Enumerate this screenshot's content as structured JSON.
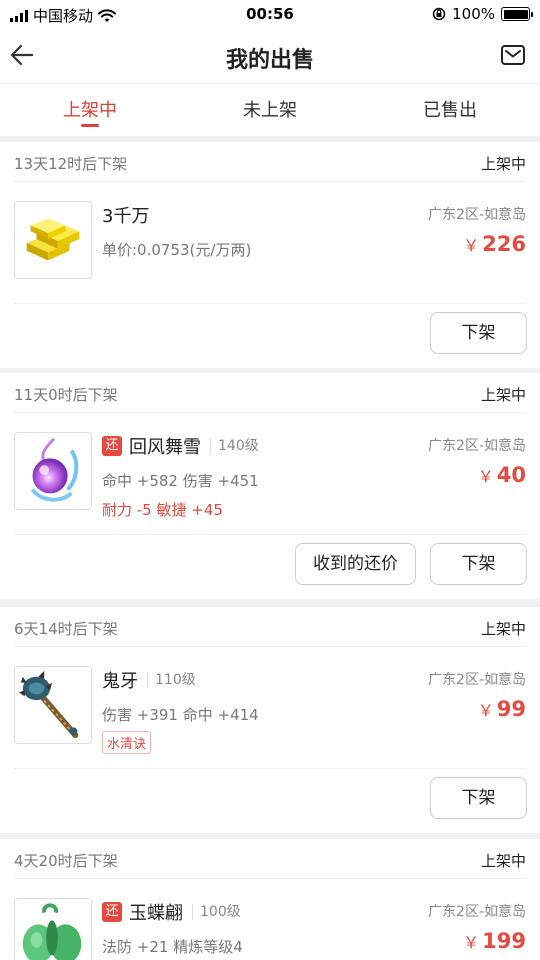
{
  "status_bar": {
    "carrier": "中国移动",
    "time": "00:56",
    "battery": "100%"
  },
  "nav": {
    "title": "我的出售",
    "back_icon": "back-arrow-icon",
    "mail_icon": "mail-icon"
  },
  "tabs": [
    {
      "label": "上架中",
      "active": true
    },
    {
      "label": "未上架",
      "active": false
    },
    {
      "label": "已售出",
      "active": false
    }
  ],
  "items": [
    {
      "expire": "13天12时后下架",
      "status": "上架中",
      "name": "3千万",
      "unit_price": "单价:0.0753(元/万两)",
      "server": "广东2区-如意岛",
      "currency": "￥",
      "price": "226",
      "icon": "gold-bars-icon",
      "buttons": {
        "off": "下架"
      }
    },
    {
      "expire": "11天0时后下架",
      "status": "上架中",
      "tag": "还",
      "name": "回风舞雪",
      "level": "140级",
      "attr": "命中 +582 伤害 +451",
      "attr2": "耐力 -5 敏捷 +45",
      "server": "广东2区-如意岛",
      "currency": "￥",
      "price": "40",
      "icon": "purple-orb-icon",
      "buttons": {
        "offers": "收到的还价",
        "off": "下架"
      }
    },
    {
      "expire": "6天14时后下架",
      "status": "上架中",
      "name": "鬼牙",
      "level": "110级",
      "attr": "伤害 +391 命中 +414",
      "special_tag": "水清诀",
      "server": "广东2区-如意岛",
      "currency": "￥",
      "price": "99",
      "icon": "spiked-mace-icon",
      "buttons": {
        "off": "下架"
      }
    },
    {
      "expire": "4天20时后下架",
      "status": "上架中",
      "tag": "还",
      "name": "玉蝶翩",
      "level": "100级",
      "attr": "法防 +21 精炼等级4",
      "server": "广东2区-如意岛",
      "currency": "￥",
      "price": "199",
      "icon": "jade-butterfly-icon"
    }
  ],
  "colors": {
    "accent": "#e0403a",
    "price": "#e64940",
    "background": "#f0f0f0"
  }
}
